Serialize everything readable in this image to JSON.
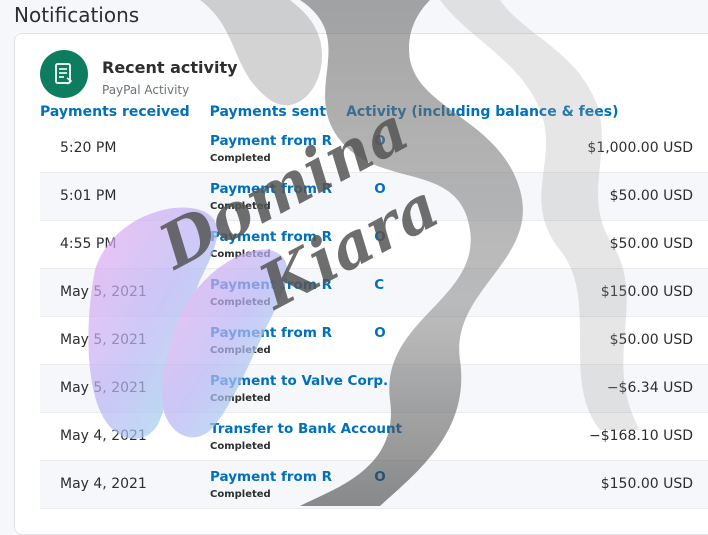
{
  "page": {
    "title": "Notifications"
  },
  "card": {
    "icon": "activity-document-icon",
    "title": "Recent activity",
    "subtitle": "PayPal Activity",
    "accent": "#0e7c5f"
  },
  "tabs": [
    {
      "label": "Payments received"
    },
    {
      "label": "Payments sent"
    },
    {
      "label": "Activity (including balance & fees)"
    }
  ],
  "transactions": [
    {
      "time": "5:20 PM",
      "description": "Payment from R         O",
      "status": "Completed",
      "amount": "$1,000.00 USD"
    },
    {
      "time": "5:01 PM",
      "description": "Payment from R         O",
      "status": "Completed",
      "amount": "$50.00 USD"
    },
    {
      "time": "4:55 PM",
      "description": "Payment from R         O",
      "status": "Completed",
      "amount": "$50.00 USD"
    },
    {
      "time": "May 5, 2021",
      "description": "Payment from R         C",
      "status": "Completed",
      "amount": "$150.00 USD"
    },
    {
      "time": "May 5, 2021",
      "description": "Payment from R         O",
      "status": "Completed",
      "amount": "$50.00 USD"
    },
    {
      "time": "May 5, 2021",
      "description": "Payment to Valve Corp.",
      "status": "Completed",
      "amount": "−$6.34 USD"
    },
    {
      "time": "May 4, 2021",
      "description": "Transfer to Bank Account",
      "status": "Completed",
      "amount": "−$168.10 USD"
    },
    {
      "time": "May 4, 2021",
      "description": "Payment from R         O",
      "status": "Completed",
      "amount": "$150.00 USD"
    }
  ],
  "watermark": {
    "text": "Domina Kiara",
    "icon": "smoke-and-feet-artwork"
  }
}
